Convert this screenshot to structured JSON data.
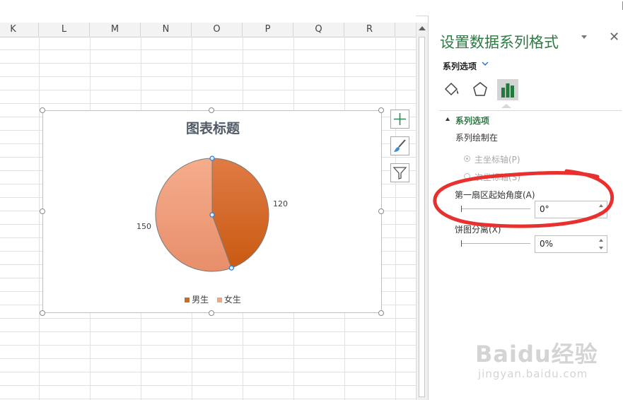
{
  "sheet": {
    "columns": [
      "K",
      "L",
      "M",
      "N",
      "O",
      "P",
      "Q",
      "R"
    ]
  },
  "chart": {
    "chart_data": {
      "type": "pie",
      "title": "图表标题",
      "categories": [
        "男生",
        "女生"
      ],
      "values": [
        120,
        150
      ],
      "colors": [
        "#d2691e",
        "#f2a380"
      ],
      "first_slice_angle_deg": 0,
      "legend_position": "bottom",
      "selected": true
    },
    "data_labels": [
      "120",
      "150"
    ]
  },
  "chart_buttons": [
    {
      "name": "chart-elements-button",
      "icon": "plus-icon"
    },
    {
      "name": "chart-styles-button",
      "icon": "paintbrush-icon"
    },
    {
      "name": "chart-filters-button",
      "icon": "funnel-icon"
    }
  ],
  "pane": {
    "title": "设置数据系列格式",
    "close_glyph": "✕",
    "sub_header": "系列选项",
    "tabs": [
      {
        "name": "fill-line-tab",
        "icon": "paint-bucket-icon",
        "selected": false
      },
      {
        "name": "effects-tab",
        "icon": "pentagon-icon",
        "selected": false
      },
      {
        "name": "series-options-tab",
        "icon": "bar-chart-icon",
        "selected": true
      }
    ],
    "section_title": "系列选项",
    "plot_on_label": "系列绘制在",
    "primary_axis_label": "主坐标轴(P)",
    "secondary_axis_label": "次坐标轴(S)",
    "first_slice_angle_label": "第一扇区起始角度(A)",
    "first_slice_angle_value": "0°",
    "explosion_label": "饼图分离(X)",
    "explosion_value": "0%"
  },
  "watermark": {
    "text": "Baidu经验",
    "sub": "jingyan.baidu.com"
  },
  "colors": {
    "accent_green": "#2e7a44",
    "annotation_red": "#e8302e"
  }
}
